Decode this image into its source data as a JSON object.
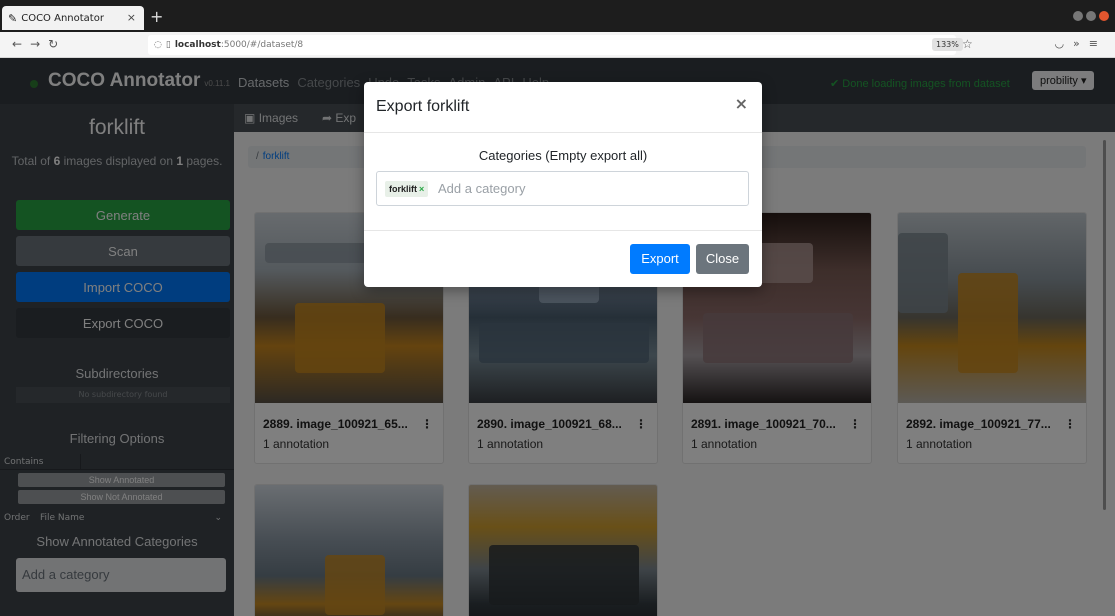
{
  "browser": {
    "tab_title": "COCO Annotator",
    "tab_close": "×",
    "new_tab": "+",
    "url_host": "localhost",
    "url_path": ":5000/#/dataset/8",
    "zoom": "133%"
  },
  "app": {
    "brand": "COCO Annotator",
    "version": "v0.11.1",
    "menu": [
      "Datasets",
      "Categories",
      "Undo",
      "Tasks",
      "Admin",
      "API",
      "Help"
    ],
    "status": "✔ Done loading images from dataset",
    "user": "probility ▾"
  },
  "sidebar": {
    "title": "forklift",
    "total_prefix": "Total of ",
    "total_count": "6",
    "total_mid": " images displayed on ",
    "total_pages": "1",
    "total_suffix": " pages.",
    "buttons": {
      "generate": "Generate",
      "scan": "Scan",
      "import": "Import COCO",
      "export": "Export COCO"
    },
    "subdirectories_heading": "Subdirectories",
    "no_subdirectory": "No subdirectory found",
    "filtering_heading": "Filtering Options",
    "contains_label": "Contains",
    "show_annotated": "Show Annotated",
    "show_not_annotated": "Show Not Annotated",
    "order_label": "Order",
    "order_value": "File Name",
    "annotated_categories_heading": "Show Annotated Categories",
    "category_placeholder": "Add a category"
  },
  "main": {
    "tabs": [
      "Images",
      "Exp"
    ],
    "breadcrumb_sep": "/",
    "breadcrumb": "forklift",
    "cards": [
      {
        "name": "2889. image_100921_65...",
        "annotations": "1 annotation"
      },
      {
        "name": "2890. image_100921_68...",
        "annotations": "1 annotation"
      },
      {
        "name": "2891. image_100921_70...",
        "annotations": "1 annotation"
      },
      {
        "name": "2892. image_100921_77...",
        "annotations": "1 annotation"
      },
      {
        "name": "",
        "annotations": ""
      },
      {
        "name": "",
        "annotations": ""
      }
    ]
  },
  "modal": {
    "title": "Export forklift",
    "close_x": "×",
    "label": "Categories (Empty export all)",
    "tag": "forklift",
    "tag_remove": "×",
    "placeholder": "Add a category",
    "export_button": "Export",
    "close_button": "Close"
  },
  "colors": {
    "primary": "#007bff",
    "success": "#28a745",
    "secondary": "#6c757d",
    "dark": "#343a40"
  }
}
